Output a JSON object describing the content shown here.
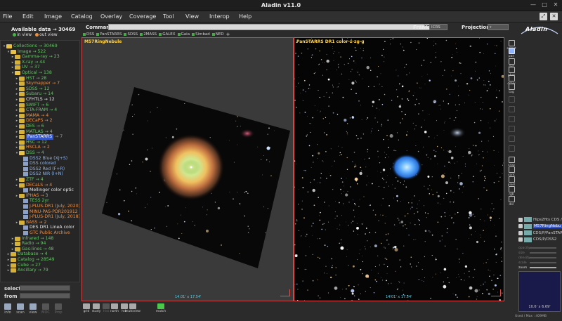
{
  "window": {
    "title": "Aladin v11.0"
  },
  "menu": [
    "File",
    "Edit",
    "Image",
    "Catalog",
    "Overlay",
    "Coverage",
    "Tool",
    "View",
    "Interop",
    "Help"
  ],
  "sidebar": {
    "available_label": "Available data → 30469",
    "in_view": "in view",
    "out_view": "out view",
    "tree": [
      {
        "t": "Collections → 30469",
        "d": 0,
        "c": "green",
        "o": 1
      },
      {
        "t": "Image → 522",
        "d": 1,
        "c": "green",
        "o": 1
      },
      {
        "t": "Gamma-ray → 23",
        "d": 2,
        "c": "green",
        "o": 0
      },
      {
        "t": "X-ray → 44",
        "d": 2,
        "c": "green",
        "o": 0
      },
      {
        "t": "UV → 37",
        "d": 2,
        "c": "green",
        "o": 0
      },
      {
        "t": "Optical → 138",
        "d": 2,
        "c": "green",
        "o": 1
      },
      {
        "t": "HST → 28",
        "d": 3,
        "c": "green",
        "o": 0
      },
      {
        "t": "Skymapper → 7",
        "d": 3,
        "c": "orange",
        "o": 0
      },
      {
        "t": "SDSS → 12",
        "d": 3,
        "c": "green",
        "o": 0
      },
      {
        "t": "Subaru → 14",
        "d": 3,
        "c": "green",
        "o": 0
      },
      {
        "t": "CFHTLS → 12",
        "d": 3,
        "c": "white",
        "o": 0
      },
      {
        "t": "SWIFT → 6",
        "d": 3,
        "c": "green",
        "o": 0
      },
      {
        "t": "CTA-FRAM → 4",
        "d": 3,
        "c": "green",
        "o": 0
      },
      {
        "t": "MAMA → 4",
        "d": 3,
        "c": "orange",
        "o": 0
      },
      {
        "t": "DECaPS → 2",
        "d": 3,
        "c": "orange",
        "o": 0
      },
      {
        "t": "DES → 6",
        "d": 3,
        "c": "green",
        "o": 0
      },
      {
        "t": "MATLAS → 4",
        "d": 3,
        "c": "green",
        "o": 0
      },
      {
        "t": "PanSTARRS",
        "d": 3,
        "c": "white",
        "o": 0,
        "sel": 1,
        "extra": "→ 7"
      },
      {
        "t": "HSC → 12",
        "d": 3,
        "c": "green",
        "o": 0
      },
      {
        "t": "HSCLA → 2",
        "d": 3,
        "c": "orange",
        "o": 0
      },
      {
        "t": "DSS → 4",
        "d": 3,
        "c": "green",
        "o": 1
      },
      {
        "t": "DSS2 Blue (XJ+S)",
        "d": 4,
        "c": "blue",
        "s": 1
      },
      {
        "t": "DSS colored",
        "d": 4,
        "c": "blue",
        "s": 1
      },
      {
        "t": "DSS2 Red (F+R)",
        "d": 4,
        "c": "blue",
        "s": 1
      },
      {
        "t": "DSS2 NIR (I+N)",
        "d": 4,
        "c": "blue",
        "s": 1
      },
      {
        "t": "ZTF → 4",
        "d": 3,
        "c": "green",
        "o": 0
      },
      {
        "t": "DECaLS → 4",
        "d": 3,
        "c": "orange",
        "o": 0
      },
      {
        "t": "Mellinger color optic",
        "d": 4,
        "c": "white",
        "s": 1
      },
      {
        "t": "IPHAS → 3",
        "d": 3,
        "c": "orange",
        "o": 0
      },
      {
        "t": "TESS 2yr",
        "d": 4,
        "c": "green",
        "s": 1
      },
      {
        "t": "J-PLUS-DR1 (July, 2020)",
        "d": 4,
        "c": "orange",
        "s": 1
      },
      {
        "t": "MINU-PAS-PDR201912 (C",
        "d": 4,
        "c": "orange",
        "s": 1
      },
      {
        "t": "J-PLUS-DR1 (July, 2018)",
        "d": 4,
        "c": "orange",
        "s": 1
      },
      {
        "t": "BASS → 2",
        "d": 3,
        "c": "orange",
        "o": 0
      },
      {
        "t": "DES DR1 LineA color",
        "d": 4,
        "c": "white",
        "s": 1
      },
      {
        "t": "GTC Public Archive",
        "d": 4,
        "c": "orange",
        "s": 1
      },
      {
        "t": "Infrared → 148",
        "d": 2,
        "c": "green",
        "o": 0
      },
      {
        "t": "Radio → 94",
        "d": 2,
        "c": "green",
        "o": 0
      },
      {
        "t": "Gas-lines → 48",
        "d": 2,
        "c": "green",
        "o": 0
      },
      {
        "t": "Database → 4",
        "d": 1,
        "c": "green",
        "o": 0
      },
      {
        "t": "Catalog → 28549",
        "d": 1,
        "c": "green",
        "o": 0
      },
      {
        "t": "Cube → 27",
        "d": 1,
        "c": "green",
        "o": 0
      },
      {
        "t": "Ancillary → 79",
        "d": 1,
        "c": "green",
        "o": 0
      }
    ],
    "select_label": "select",
    "from_label": "from",
    "tools": [
      {
        "label": "info",
        "dim": 0
      },
      {
        "label": "scan",
        "dim": 0
      },
      {
        "label": "view",
        "dim": 0
      },
      {
        "label": "MOC",
        "dim": 1
      },
      {
        "label": "Prop",
        "dim": 1
      }
    ]
  },
  "command": {
    "label": "Command",
    "frame_label": "Frame",
    "frame_value": "ICRS",
    "projection_label": "Projection"
  },
  "bookmarks": [
    "DSS",
    "PanSTARRS",
    "SDSS",
    "2MASS",
    "GALEX",
    "Gaia",
    "Simbad",
    "NED",
    "+"
  ],
  "logo": "Aladin",
  "views": [
    {
      "label": "M57RingNebule",
      "fov": "14.01' x 17.54'"
    },
    {
      "label": "PanSTARRS DR1 color-z-zg-g",
      "fov": "14.01' x 17.54'"
    }
  ],
  "right_tools": [
    {
      "label": "select",
      "dim": 0,
      "act": 0
    },
    {
      "label": "pan",
      "dim": 0,
      "act": 1
    },
    {
      "label": "dist",
      "dim": 0,
      "act": 0
    },
    {
      "label": "phot",
      "dim": 0,
      "act": 0
    },
    {
      "label": "draw",
      "dim": 0,
      "act": 0
    },
    {
      "label": "tag",
      "dim": 0,
      "act": 0
    },
    {
      "label": "",
      "dim": 1,
      "act": 0
    },
    {
      "label": "",
      "dim": 1,
      "act": 0
    },
    {
      "label": "",
      "dim": 1,
      "act": 0
    },
    {
      "label": "",
      "dim": 1,
      "act": 0
    },
    {
      "label": "",
      "dim": 1,
      "act": 0
    },
    {
      "label": "",
      "dim": 1,
      "act": 0
    },
    {
      "label": "crop",
      "dim": 0,
      "act": 0
    },
    {
      "label": "cont",
      "dim": 0,
      "act": 0
    },
    {
      "label": "pixel",
      "dim": 0,
      "act": 0
    },
    {
      "label": "rgb",
      "dim": 0,
      "act": 0
    },
    {
      "label": "del",
      "dim": 0,
      "act": 0
    }
  ],
  "planes": [
    {
      "name": "Hips2fits CDS /",
      "sel": 0
    },
    {
      "name": "M57RingNebu",
      "sel": 1
    },
    {
      "name": "CDS/P/PanSTAR",
      "sel": 0
    },
    {
      "name": "CDS/P/DSS2",
      "sel": 0
    }
  ],
  "sliders": [
    {
      "name": "opacity",
      "on": 0
    },
    {
      "name": "size",
      "on": 0
    },
    {
      "name": "density",
      "on": 0
    },
    {
      "name": "scale",
      "on": 0
    },
    {
      "name": "zoom",
      "on": 1
    }
  ],
  "preview_fov": "10.6' x 6.69'",
  "bottom_tools": [
    {
      "label": "grid",
      "dim": 0,
      "g": 0
    },
    {
      "label": "study",
      "dim": 0,
      "g": 0
    },
    {
      "label": "hist",
      "dim": 1,
      "g": 0
    },
    {
      "label": "north",
      "dim": 0,
      "g": 0
    },
    {
      "label": "hdr",
      "dim": 0,
      "g": 0
    },
    {
      "label": "multiview",
      "dim": 0,
      "g": 0
    },
    {
      "label": "match",
      "dim": 0,
      "g": 1
    }
  ],
  "status": "Used / Max : 409MB"
}
